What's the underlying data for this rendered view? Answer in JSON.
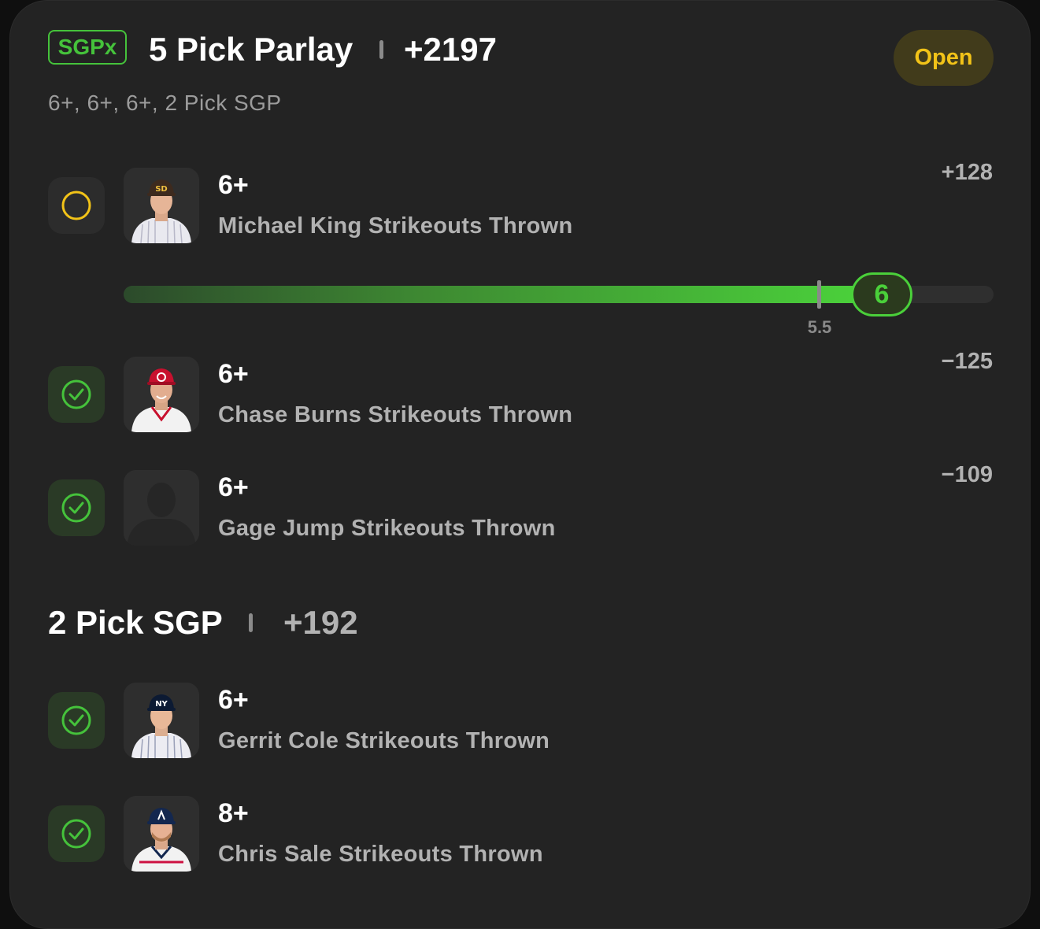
{
  "header": {
    "badge": "SGPx",
    "title": "5 Pick Parlay",
    "odds": "+2197",
    "status": "Open",
    "subtitle": "6+, 6+, 6+, 2 Pick SGP"
  },
  "picks": [
    {
      "line": "6+",
      "description": "Michael King Strikeouts Thrown",
      "odds": "+128",
      "status": "open",
      "avatar": "padres-player-photo"
    },
    {
      "line": "6+",
      "description": "Chase Burns Strikeouts Thrown",
      "odds": "−125",
      "status": "won",
      "avatar": "reds-player-photo"
    },
    {
      "line": "6+",
      "description": "Gage Jump Strikeouts Thrown",
      "odds": "−109",
      "status": "won",
      "avatar": "placeholder-silhouette"
    }
  ],
  "progress": {
    "current": "6",
    "line_label": "5.5",
    "line_value": 5.5,
    "current_value": 6,
    "fraction_filled": 0.87
  },
  "sgp": {
    "title": "2 Pick SGP",
    "odds": "+192",
    "picks": [
      {
        "line": "6+",
        "description": "Gerrit Cole Strikeouts Thrown",
        "status": "won",
        "avatar": "yankees-player-photo"
      },
      {
        "line": "8+",
        "description": "Chris Sale Strikeouts Thrown",
        "status": "won",
        "avatar": "braves-player-photo"
      }
    ]
  },
  "colors": {
    "accent_green": "#45c23b",
    "open_yellow": "#f2c318",
    "card_bg": "#232323"
  }
}
